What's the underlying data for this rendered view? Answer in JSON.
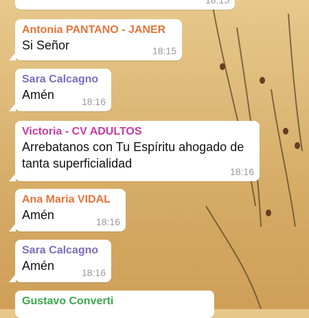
{
  "messages": [
    {
      "sender": "",
      "text": "",
      "time": "18:15",
      "color": ""
    },
    {
      "sender": "Antonia PANTANO - JANER",
      "text": "Si Señor",
      "time": "18:15",
      "color": "#e8743b"
    },
    {
      "sender": "Sara Calcagno",
      "text": "Amén",
      "time": "18:16",
      "color": "#7b6cc0"
    },
    {
      "sender": "Victoria - CV ADULTOS",
      "text": "Arrebatanos con Tu Espíritu ahogado de tanta superficialidad",
      "time": "18:16",
      "color": "#c93aa0"
    },
    {
      "sender": "Ana Maria VIDAL",
      "text": "Amén",
      "time": "18:16",
      "color": "#e8743b"
    },
    {
      "sender": "Sara Calcagno",
      "text": "Amén",
      "time": "18:16",
      "color": "#7b6cc0"
    },
    {
      "sender": "Gustavo Converti",
      "text": "",
      "time": "",
      "color": "#3aaa4a"
    }
  ]
}
